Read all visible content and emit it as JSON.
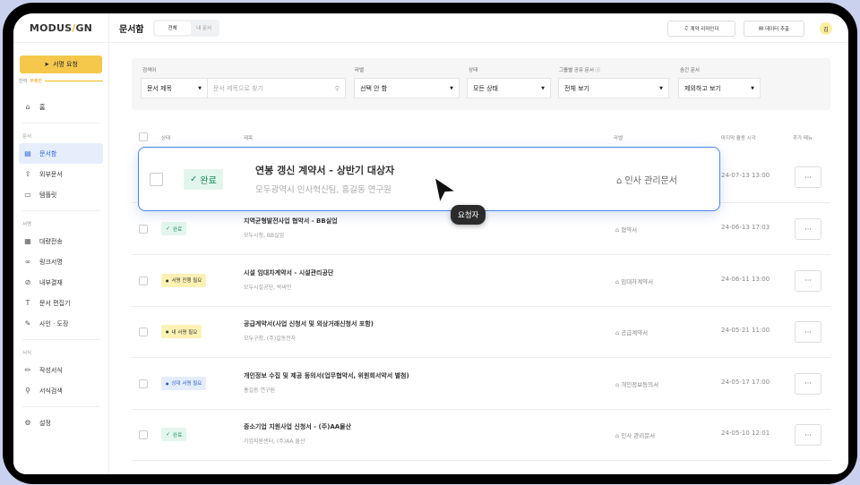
{
  "app": {
    "logo": "MODUS/GN",
    "request_button": "서명 요청",
    "remaining_label": "잔여",
    "remaining_value": "무제한"
  },
  "sidebar": {
    "home": "홈",
    "sections": [
      {
        "title": "문서",
        "items": [
          "문서함",
          "외부문서",
          "템플릿"
        ]
      },
      {
        "title": "서명",
        "items": [
          "대량전송",
          "링크서명",
          "내부결재",
          "문서 편집기",
          "사인 · 도장"
        ]
      },
      {
        "title": "서식",
        "items": [
          "작성서식",
          "서식검색"
        ]
      }
    ],
    "settings": "설정"
  },
  "header": {
    "title": "문서함",
    "tabs": [
      "전체",
      "내 문서"
    ],
    "reminder": "계약 리마인더",
    "export": "데이터 추출",
    "avatar": "김"
  },
  "filters": {
    "search_label": "검색어",
    "search_type": "문서 제목",
    "search_placeholder": "문서 제목으로 찾기",
    "label_label": "라벨",
    "label_value": "선택 안 함",
    "status_label": "상태",
    "status_value": "모든 상태",
    "group_label": "그룹별 공유 문서",
    "group_value": "전체 보기",
    "hidden_label": "숨긴 문서",
    "hidden_value": "제외하고 보기"
  },
  "table": {
    "headers": {
      "status": "상태",
      "title": "제목",
      "label": "라벨",
      "time": "마지막 활동 시각",
      "menu": "추가 메뉴"
    },
    "highlight": {
      "status": "완료",
      "title": "연봉 갱신 계약서 - 상반기 대상자",
      "sub": "모두광역시 인사혁신팀, 홍길동 연구원",
      "label": "인사 관리문서",
      "time": "24-07-13 13:00",
      "tooltip": "요청자"
    },
    "rows": [
      {
        "status": "완료",
        "kind": "done",
        "title": "지역균형발전사업 협약서 - BB실업",
        "sub": "모두시청, BB실업",
        "label": "협약서",
        "time": "24-06-13 17:03"
      },
      {
        "status": "서명 진행 필요",
        "kind": "yel",
        "title": "시설 임대차계약서 - 시설관리공단",
        "sub": "모두시설공단, 박싸인",
        "label": "임대차계약서",
        "time": "24-06-11 13:00"
      },
      {
        "status": "내 서명 필요",
        "kind": "yel",
        "title": "공급계약서(사업 신청서 및 외상거래신청서 포함)",
        "sub": "모두구청, (주)길동전자",
        "label": "공급계약서",
        "time": "24-05-21 11:00"
      },
      {
        "status": "상대 서명 필요",
        "kind": "blue",
        "title": "개인정보 수집 및 제공 동의서(업무협약서, 위원회서약서 별첨)",
        "sub": "홍길동 연구원",
        "label": "개인정보동의서",
        "time": "24-05-17 17:00"
      },
      {
        "status": "완료",
        "kind": "done",
        "title": "중소기업 지원사업 신청서 - (주)AA물산",
        "sub": "기업지원센터, (주)AA 물산",
        "label": "인사 관리문서",
        "time": "24-05-10 12:01"
      }
    ],
    "more": "···"
  },
  "colors": {
    "accent": "#2f64d8",
    "brand_yellow": "#f5c84c"
  }
}
